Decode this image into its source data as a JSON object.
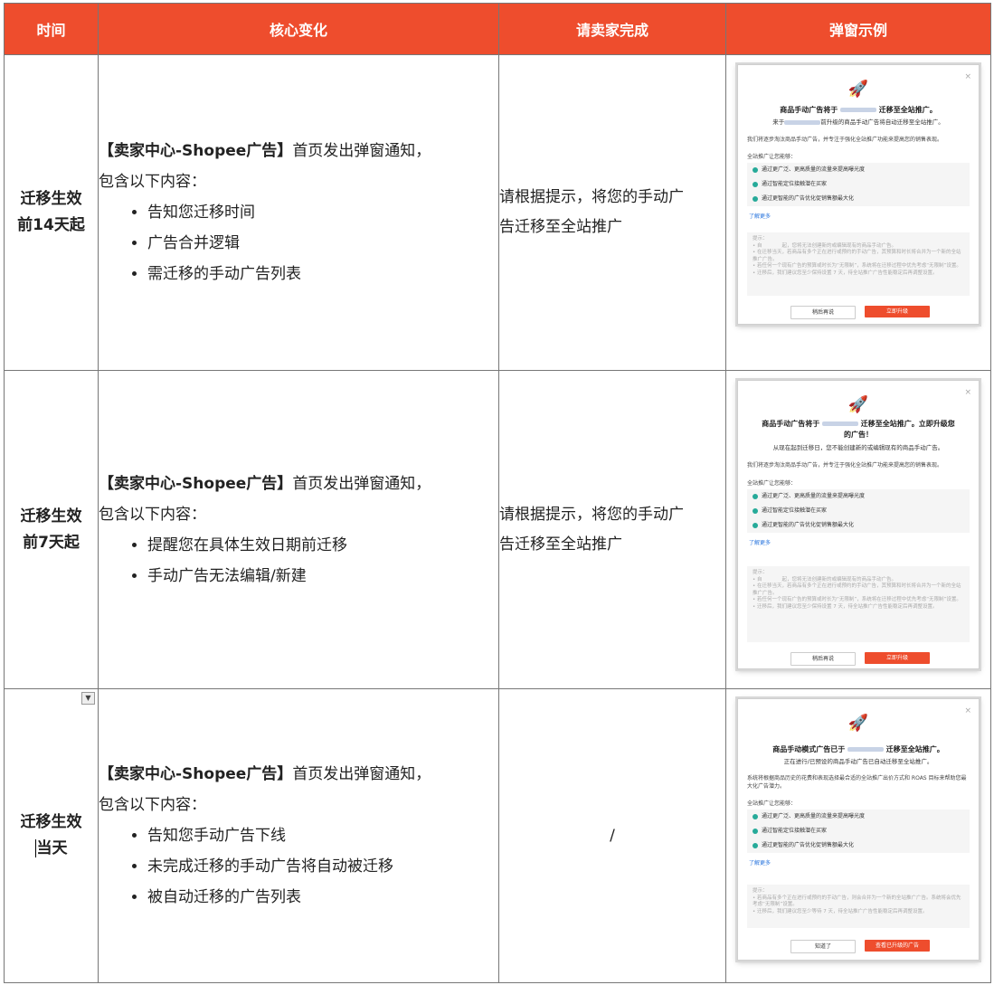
{
  "headers": [
    "时间",
    "核心变化",
    "请卖家完成",
    "弹窗示例"
  ],
  "rows": [
    {
      "time_line1": "迁移生效",
      "time_line2": "前14天起",
      "core_lead": "【卖家中心-Shopee广告】",
      "core_rest": "首页发出弹窗通知，",
      "core_line2": "包含以下内容：",
      "bullets": [
        "告知您迁移时间",
        "广告合并逻辑",
        "需迁移的手动广告列表"
      ],
      "todo_line1": "请根据提示，将您的手动广",
      "todo_line2": "告迁移至全站推广",
      "popup": {
        "close": "×",
        "rocket": "🚀",
        "title_a": "商品手动广告将于",
        "title_b": "迁移至全站推广。",
        "sub_a": "来于",
        "sub_b": "前升级的商品手动广告将自动迁移至全站推广。",
        "desc": "我们将逐步淘汰商品手动广告，并专注于强化全站推广功能来提高您的销售表现。",
        "label": "全站推广让您能够：",
        "features": [
          "通过更广泛、更高质量的流量来提高曝光度",
          "通过智能定位接触潜在买家",
          "通过更智能的广告优化促销售额最大化"
        ],
        "more": "了解更多",
        "tips_title": "提示：",
        "tips": [
          "• 自　　　　起，您将无法创建新的或编辑现有的商品手动广告。",
          "• 在迁移当天，若商品有多个正在进行或预约的手动广告，其预算和时长将合并为一个新的全站推广广告。",
          "• 若任何一个现有广告的预算或时长为“无限制”，系统将在迁移过程中优先考虑“无限制”设置。",
          "• 迁移后，我们建议您至少保持设置 7 天，待全站推广广告性能稳定后再调整设置。"
        ],
        "btn_secondary": "稍后再说",
        "btn_primary": "立即升级"
      }
    },
    {
      "time_line1": "迁移生效",
      "time_line2": "前7天起",
      "core_lead": "【卖家中心-Shopee广告】",
      "core_rest": "首页发出弹窗通知，",
      "core_line2": "包含以下内容：",
      "bullets": [
        "提醒您在具体生效日期前迁移",
        "手动广告无法编辑/新建"
      ],
      "todo_line1": "请根据提示，将您的手动广",
      "todo_line2": "告迁移至全站推广",
      "popup": {
        "close": "×",
        "rocket": "🚀",
        "title_a": "商品手动广告将于",
        "title_b": "迁移至全站推广。立即升级您",
        "title_c": "的广告！",
        "sub_a": "从现在起到迁移日，您不能创建新的或编辑现有的商品手动广告。",
        "desc": "我们将逐步淘汰商品手动广告，并专注于强化全站推广功能来提高您的销售表现。",
        "label": "全站推广让您能够：",
        "features": [
          "通过更广泛、更高质量的流量来提高曝光度",
          "通过智能定位接触潜在买家",
          "通过更智能的广告优化促销售额最大化"
        ],
        "more": "了解更多",
        "tips_title": "提示：",
        "tips": [
          "• 自　　　　起，您将无法创建新的或编辑现有的商品手动广告。",
          "• 在迁移当天，若商品有多个正在进行或预约的手动广告，其预算和时长将合并为一个新的全站推广广告。",
          "• 若任何一个现有广告的预算或时长为“无限制”，系统将在迁移过程中优先考虑“无限制”设置。",
          "• 迁移后，我们建议您至少保持设置 7 天，待全站推广广告性能稳定后再调整设置。"
        ],
        "btn_secondary": "稍后再说",
        "btn_primary": "立即升级"
      }
    },
    {
      "time_line1": "迁移生效",
      "time_line2": "当天",
      "core_lead": "【卖家中心-Shopee广告】",
      "core_rest": "首页发出弹窗通知，",
      "core_line2": "包含以下内容：",
      "bullets": [
        "告知您手动广告下线",
        "未完成迁移的手动广告将自动被迁移",
        "被自动迁移的广告列表"
      ],
      "todo_line1": "/",
      "popup": {
        "close": "×",
        "rocket": "🚀",
        "title_a": "商品手动模式广告已于",
        "title_b": "迁移至全站推广。",
        "sub_a": "正在进行/已预设的商品手动广告已自动迁移至全站推广。",
        "desc": "系统将根据商品历史的花费和表现选择最合适的全站推广出价方式和 ROAS 目标来帮助您最大化广告潜力。",
        "label": "全站推广让您能够：",
        "features": [
          "通过更广泛、更高质量的流量来提高曝光度",
          "通过智能定位接触潜在买家",
          "通过更智能的广告优化促销售额最大化"
        ],
        "more": "了解更多",
        "tips_title": "提示：",
        "tips": [
          "• 若商品有多个正在进行或预约的手动广告，则会合并为一个新的全站推广广告。系统将会优先考虑“无限制”设置。",
          "• 迁移后，我们建议您至少等待 7 天，待全站推广广告性能稳定后再调整设置。"
        ],
        "btn_secondary": "知道了",
        "btn_primary": "查看已升级的广告"
      }
    }
  ]
}
